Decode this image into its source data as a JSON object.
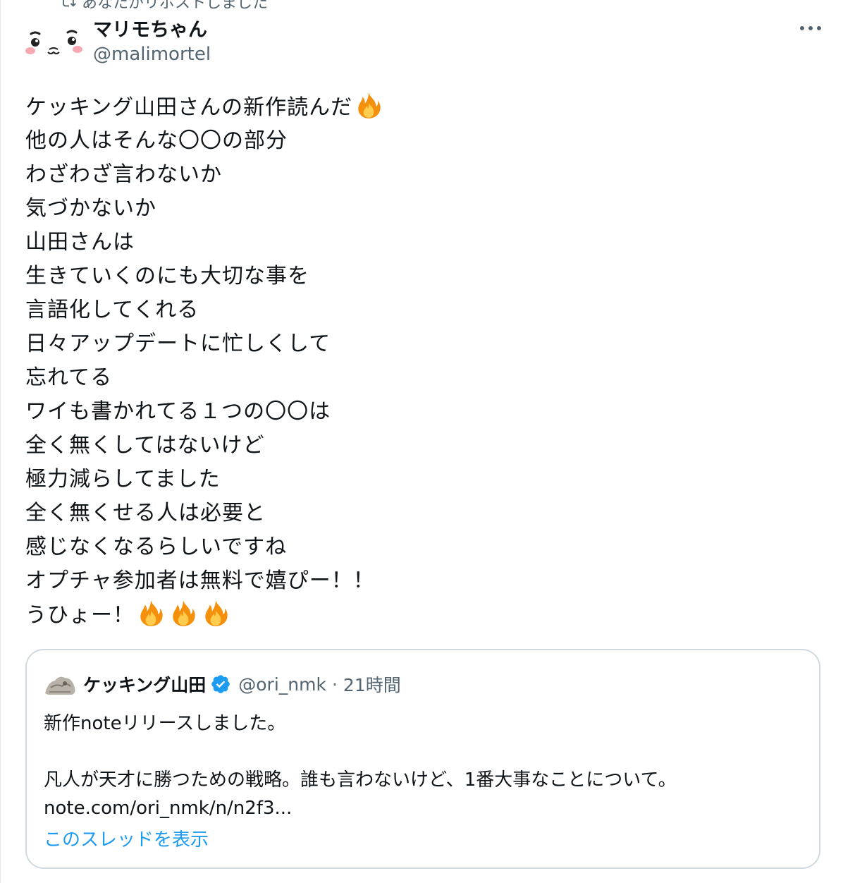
{
  "repost": {
    "label": "あなたがリポストしました"
  },
  "author": {
    "display_name": "マリモちゃん",
    "handle": "@malimortel"
  },
  "post": {
    "lines": [
      "ケッキング山田さんの新作読んだ",
      "他の人はそんな〇〇の部分",
      "わざわざ言わないか",
      "気づかないか",
      "山田さんは",
      "生きていくのにも大切な事を",
      "言語化してくれる",
      "日々アップデートに忙しくして",
      "忘れてる",
      "ワイも書かれてる１つの〇〇は",
      "全く無くしてはないけど",
      "極力減らしてました",
      "全く無くせる人は必要と",
      "感じなくなるらしいですね",
      "オプチャ参加者は無料で嬉ぴー！！",
      "うひょー！"
    ],
    "emoji": "fire-icon"
  },
  "quote": {
    "display_name": "ケッキング山田",
    "verified": true,
    "handle": "@ori_nmk",
    "separator": "·",
    "time": "21時間",
    "text_lines": [
      "新作noteリリースしました。",
      "",
      "凡人が天才に勝つための戦略。誰も言わないけど、1番大事なことについて。",
      "note.com/ori_nmk/n/n2f3..."
    ],
    "show_thread": "このスレッドを表示"
  },
  "colors": {
    "text": "#0f1419",
    "secondary": "#536471",
    "link": "#1d9bf0",
    "border": "#cfd9de",
    "verified": "#1d9bf0"
  }
}
